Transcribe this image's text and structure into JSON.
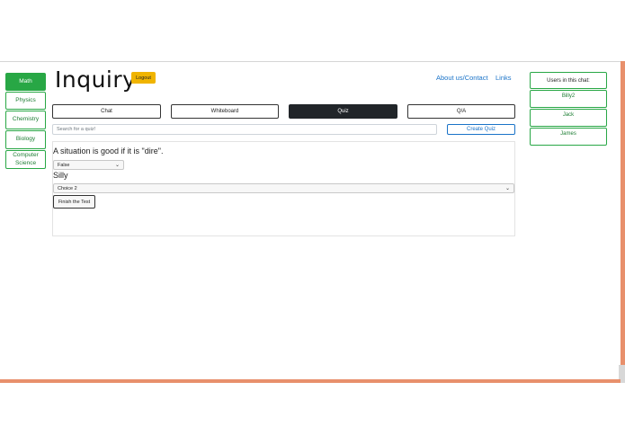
{
  "app": {
    "title": "Inquiry",
    "logout_label": "Logout"
  },
  "subjects": [
    "Math",
    "Physics",
    "Chemistry",
    "Biology",
    "Computer Science"
  ],
  "top_links": [
    "About us/Contact",
    "Links"
  ],
  "tabs": [
    "Chat",
    "Whiteboard",
    "Quiz",
    "Q/A"
  ],
  "active_tab": "Quiz",
  "search": {
    "placeholder": "Search for a quiz!"
  },
  "create_quiz_label": "Create Quiz",
  "quiz": {
    "q1": {
      "text": "A situation is good if it is \"dire\".",
      "selected": "False"
    },
    "q2": {
      "text": "Silly",
      "selected": "Choice 2"
    },
    "finish_label": "Finish the Test"
  },
  "users_panel": {
    "header": "Users in this chat:",
    "users": [
      "Billy2",
      "Jack",
      "James"
    ]
  },
  "colors": {
    "accent_green": "#28a745",
    "link_blue": "#1a73c8",
    "logout_yellow": "#f0b400",
    "active_tab": "#212529",
    "frame_orange": "#e8906c"
  },
  "icons": {
    "select_caret": "chevron-down-icon"
  }
}
